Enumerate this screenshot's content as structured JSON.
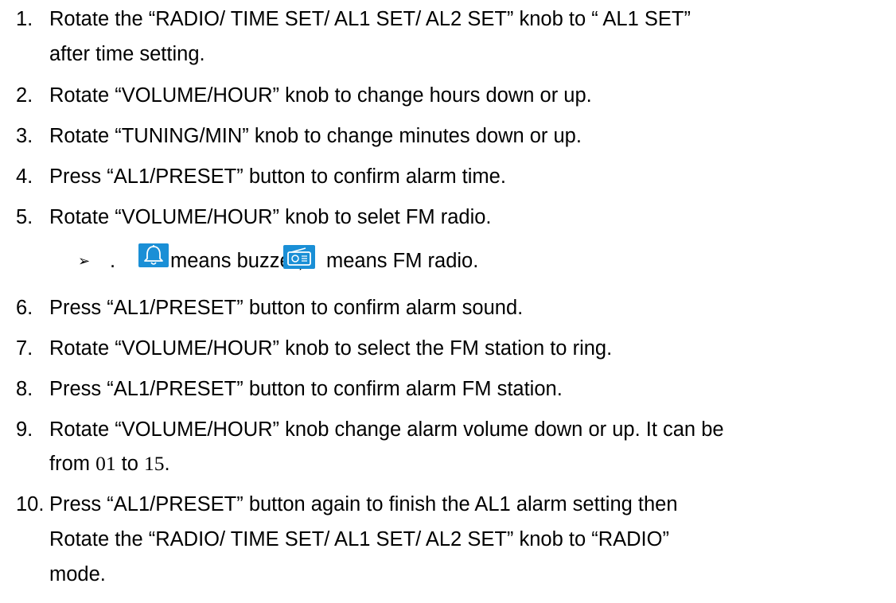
{
  "steps": [
    {
      "num": "1.",
      "text": "Rotate the “RADIO/ TIME SET/ AL1 SET/ AL2 SET” knob to “ AL1 SET”",
      "cont": "after time setting."
    },
    {
      "num": "2.",
      "text": "Rotate “VOLUME/HOUR” knob to change hours down or up."
    },
    {
      "num": "3.",
      "text": "Rotate “TUNING/MIN” knob to change minutes down or up."
    },
    {
      "num": "4.",
      "text": "Press “AL1/PRESET” button to confirm alarm time."
    },
    {
      "num": "5.",
      "text": "Rotate “VOLUME/HOUR” knob to selet FM radio."
    },
    {
      "num": "6.",
      "text": "Press “AL1/PRESET” button to confirm alarm sound."
    },
    {
      "num": "7.",
      "text": "Rotate “VOLUME/HOUR” knob to select the FM station to ring."
    },
    {
      "num": "8.",
      "text": "Press “AL1/PRESET” button to confirm alarm FM station."
    },
    {
      "num": "9.",
      "text": "Rotate “VOLUME/HOUR” knob change alarm volume down or up. It can be",
      "cont_pre": "from ",
      "cont_n1": "01",
      "cont_mid": " to ",
      "cont_n2": "15",
      "cont_post": "."
    },
    {
      "num": "10.",
      "text": "Press “AL1/PRESET” button again to finish the AL1 alarm setting then",
      "cont": "Rotate the “RADIO/ TIME SET/ AL1 SET/ AL2 SET” knob to “RADIO”",
      "cont2": "mode."
    }
  ],
  "bullet": {
    "arrow": "➢",
    "dot": ".",
    "buzzer_icon": "bell-icon",
    "buzzer_text": "means buzzer;",
    "radio_icon": "radio-icon",
    "radio_text": "means FM radio."
  },
  "colors": {
    "icon_background": "#1a8fd6",
    "icon_line": "#ffffff"
  }
}
